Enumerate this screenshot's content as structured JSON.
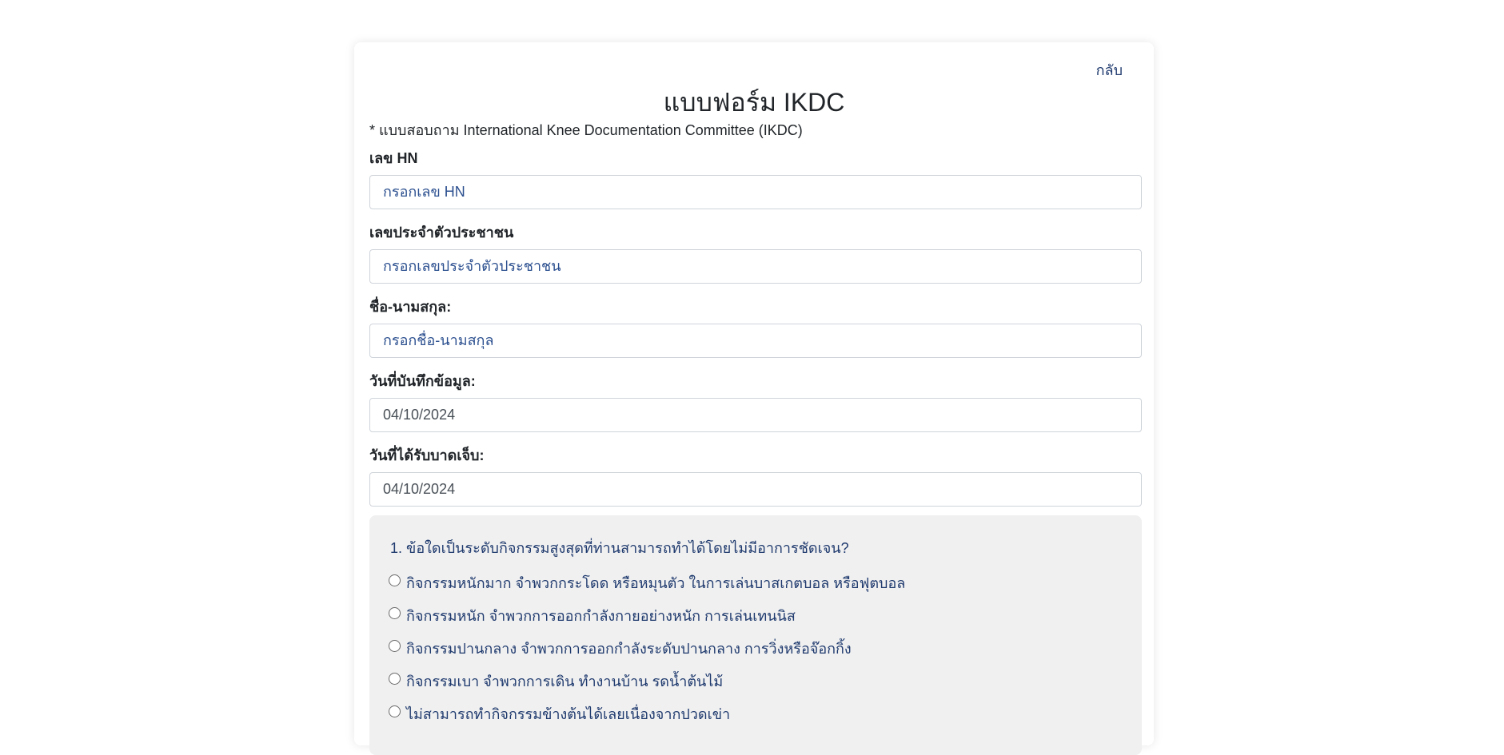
{
  "header": {
    "back_label": "กลับ",
    "title": "แบบฟอร์ม IKDC",
    "subtitle": "* แบบสอบถาม International Knee Documentation Committee (IKDC)"
  },
  "fields": {
    "hn": {
      "label": "เลข HN",
      "placeholder": "กรอกเลข HN",
      "value": ""
    },
    "citizen_id": {
      "label": "เลขประจำตัวประชาชน",
      "placeholder": "กรอกเลขประจำตัวประชาชน",
      "value": ""
    },
    "full_name": {
      "label": "ชื่อ-นามสกุล:",
      "placeholder": "กรอกชื่อ-นามสกุล",
      "value": ""
    },
    "record_date": {
      "label": "วันที่บันทึกข้อมูล:",
      "value": "04/10/2024"
    },
    "injury_date": {
      "label": "วันที่ได้รับบาดเจ็บ:",
      "value": "04/10/2024"
    }
  },
  "question1": {
    "text": "1. ข้อใดเป็นระดับกิจกรรมสูงสุดที่ท่านสามารถทำได้โดยไม่มีอาการชัดเจน?",
    "options": [
      "กิจกรรมหนักมาก จำพวกกระโดด หรือหมุนตัว ในการเล่นบาสเกตบอล หรือฟุตบอล",
      "กิจกรรมหนัก จำพวกการออกกำลังกายอย่างหนัก การเล่นเทนนิส",
      "กิจกรรมปานกลาง จำพวกการออกกำลังระดับปานกลาง การวิ่งหรือจ๊อกกิ้ง",
      "กิจกรรมเบา จำพวกการเดิน ทำงานบ้าน รดน้ำต้นไม้",
      "ไม่สามารถทำกิจกรรมข้างต้นได้เลยเนื่องจากปวดเข่า"
    ]
  },
  "colors": {
    "text_primary": "#212529",
    "text_blue": "#1f3a6e",
    "panel_bg": "#f0f0f0",
    "border": "#cfd4da"
  }
}
